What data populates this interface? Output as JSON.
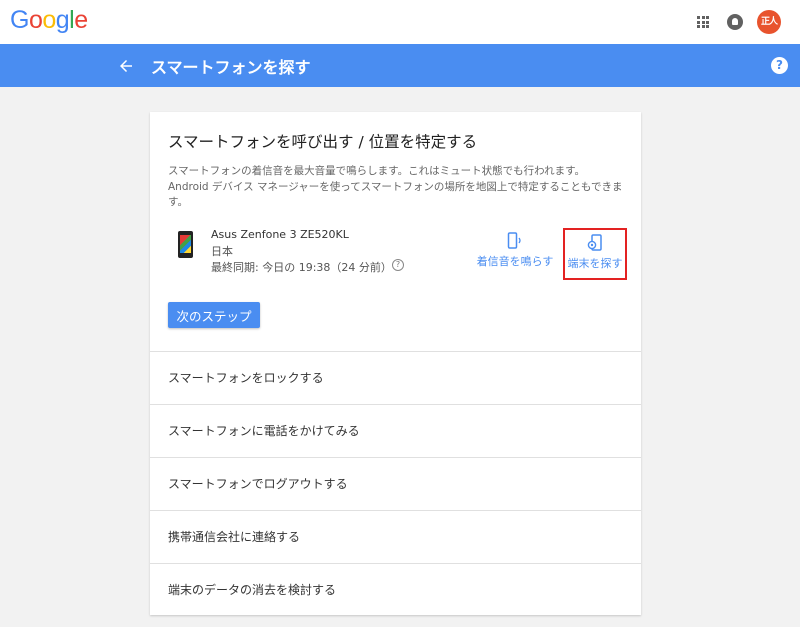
{
  "header": {
    "logo": [
      "G",
      "o",
      "o",
      "g",
      "l",
      "e"
    ],
    "logo_colors": [
      "#4285F4",
      "#EA4335",
      "#FBBC05",
      "#4285F4",
      "#34A853",
      "#EA4335"
    ],
    "avatar_text": "正人",
    "avatar_color": "#e8532d",
    "icons": [
      "apps-icon",
      "notifications-icon"
    ]
  },
  "toolbar": {
    "title": "スマートフォンを探す",
    "color": "#4a8df1",
    "icons": [
      "back-arrow-icon",
      "help-icon"
    ],
    "help_glyph": "?"
  },
  "card": {
    "title": "スマートフォンを呼び出す / 位置を特定する",
    "description": "スマートフォンの着信音を最大音量で鳴らします。これはミュート状態でも行われます。Android デバイス マネージャーを使ってスマートフォンの場所を地図上で特定することもできます。",
    "device": {
      "name": "Asus Zenfone 3 ZE520KL",
      "country": "日本",
      "last_sync": "最終同期: 今日の 19:38（24 分前）",
      "help_glyph": "?"
    },
    "actions": {
      "ring_label": "着信音を鳴らす",
      "find_label": "端末を探す",
      "highlight_color": "#e32222"
    },
    "next_button": "次のステップ"
  },
  "menu": [
    "スマートフォンをロックする",
    "スマートフォンに電話をかけてみる",
    "スマートフォンでログアウトする",
    "携帯通信会社に連絡する",
    "端末のデータの消去を検討する"
  ]
}
